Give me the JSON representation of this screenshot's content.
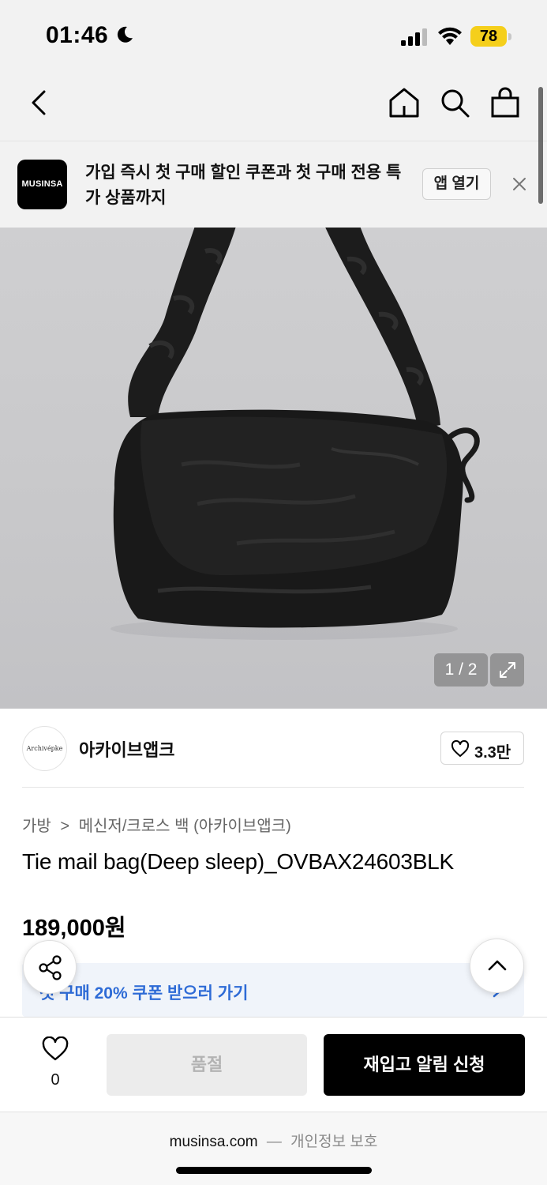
{
  "status_bar": {
    "time": "01:46",
    "battery": "78"
  },
  "promo": {
    "logo_text": "MUSINSA",
    "message": "가입 즉시 첫 구매 할인 쿠폰과 첫 구매 전용 특가 상품까지",
    "open_app_label": "앱 열기"
  },
  "gallery": {
    "counter": "1 / 2"
  },
  "brand": {
    "avatar_text": "Archivépke",
    "name": "아카이브앱크",
    "likes": "3.3만"
  },
  "breadcrumb": {
    "category": "가방",
    "separator": ">",
    "subcategory": "메신저/크로스 백 (아카이브앱크)"
  },
  "product": {
    "title": "Tie mail bag(Deep sleep)_OVBAX24603BLK",
    "price": "189,000원"
  },
  "coupon": {
    "text": "첫 구매 20% 쿠폰 받으러 가기"
  },
  "action_bar": {
    "wish_count": "0",
    "soldout_label": "품절",
    "restock_label": "재입고 알림 신청"
  },
  "browser": {
    "domain": "musinsa.com",
    "separator": "—",
    "privacy_label": "개인정보 보호"
  },
  "colors": {
    "accent_black": "#000000",
    "coupon_blue": "#2e6bd6",
    "battery_yellow": "#f5cf1b"
  }
}
